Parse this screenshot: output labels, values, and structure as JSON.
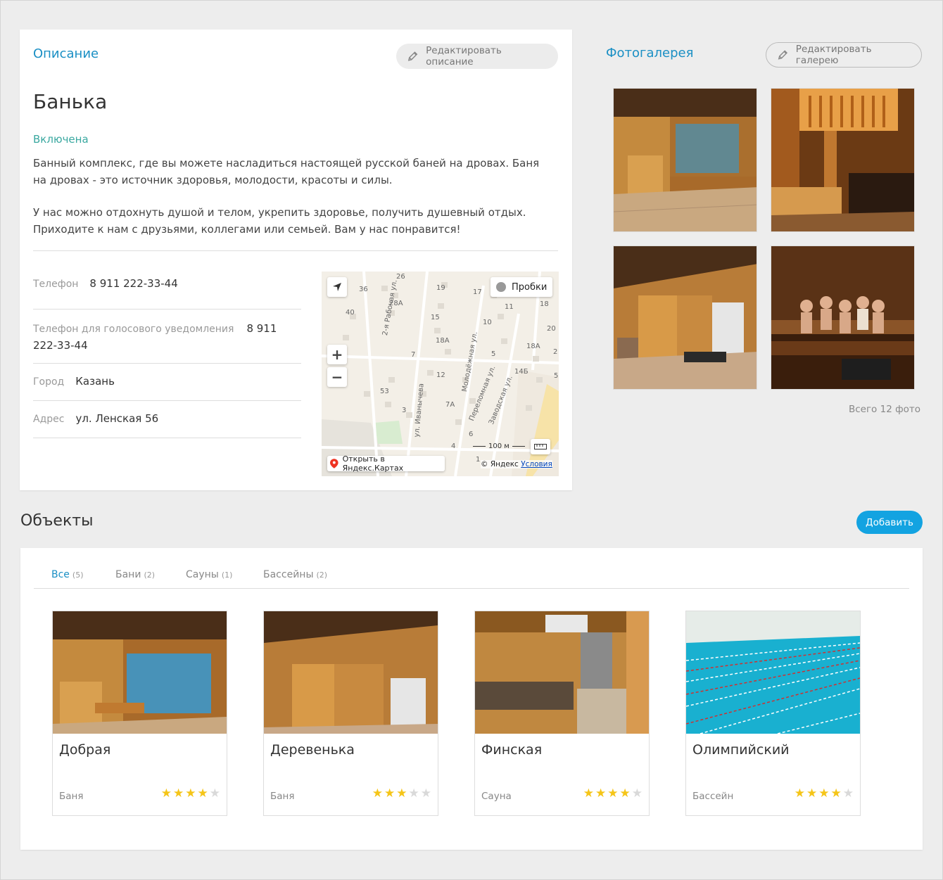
{
  "description": {
    "title": "Описание",
    "edit_label": "Редактировать описание",
    "name": "Банька",
    "status": "Включена",
    "paragraphs": [
      "Банный комплекс, где вы можете насладиться настоящей русской баней на дровах. Баня на дровах - это источник здоровья, молодости, красоты и силы.",
      "У нас можно отдохнуть душой и телом, укрепить здоровье, получить душевный отдых. Приходите к нам с друзьями, коллегами или семьей. Вам у нас понравится!"
    ],
    "fields": [
      {
        "label": "Телефон",
        "value": "8 911 222-33-44"
      },
      {
        "label": "Телефон для голосового уведомления",
        "value": "8 911 222-33-44"
      },
      {
        "label": "Город",
        "value": "Казань"
      },
      {
        "label": "Адрес",
        "value": "ул. Ленская 56"
      }
    ]
  },
  "map": {
    "traffic_label": "Пробки",
    "open_label": "Открыть в Яндекс.Картах",
    "scale_label": "100 м",
    "copyright": "© Яндекс",
    "terms": "Условия",
    "streets": [
      "2-я Рабочая ул.",
      "Молодёжная ул.",
      "Переломная ул.",
      "Заводская ул.",
      "ул. Иванычева",
      "Заводская ул."
    ],
    "numbers": [
      "26",
      "36",
      "19",
      "17",
      "28А",
      "40",
      "15",
      "11",
      "18",
      "10",
      "20",
      "18А",
      "18А",
      "5",
      "14Б",
      "12",
      "7",
      "53",
      "7А",
      "3",
      "6",
      "4",
      "1",
      "2",
      "5"
    ]
  },
  "gallery": {
    "title": "Фотогалерея",
    "edit_label": "Редактировать галерею",
    "total_label": "Всего 12 фото"
  },
  "objects": {
    "title": "Объекты",
    "add_label": "Добавить",
    "tabs": [
      {
        "label": "Все",
        "count": "(5)"
      },
      {
        "label": "Бани",
        "count": "(2)"
      },
      {
        "label": "Сауны",
        "count": "(1)"
      },
      {
        "label": "Бассейны",
        "count": "(2)"
      }
    ],
    "items": [
      {
        "name": "Добрая",
        "type": "Баня",
        "rating": 4
      },
      {
        "name": "Деревенька",
        "type": "Баня",
        "rating": 3
      },
      {
        "name": "Финская",
        "type": "Сауна",
        "rating": 4
      },
      {
        "name": "Олимпийский",
        "type": "Бассейн",
        "rating": 4
      }
    ]
  },
  "colors": {
    "accent": "#1a8fc4",
    "status": "#3aa8a0",
    "add_button": "#13a3e1",
    "star_on": "#f5c518",
    "star_off": "#d9d9d9"
  }
}
